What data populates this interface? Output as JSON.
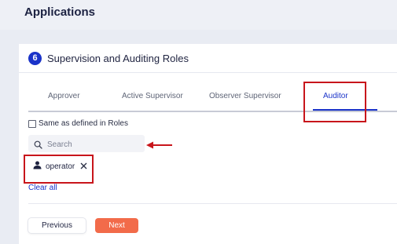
{
  "header": {
    "title": "Applications"
  },
  "section": {
    "step_number": "6",
    "title": "Supervision and Auditing Roles"
  },
  "tabs": [
    {
      "label": "Approver",
      "active": false
    },
    {
      "label": "Active Supervisor",
      "active": false
    },
    {
      "label": "Observer Supervisor",
      "active": false
    },
    {
      "label": "Auditor",
      "active": true
    }
  ],
  "same_as_roles": {
    "label": "Same as defined in Roles",
    "checked": false
  },
  "search": {
    "placeholder": "Search",
    "value": ""
  },
  "selected_chips": [
    {
      "label": "operator",
      "icon": "user-icon"
    }
  ],
  "clear_all_label": "Clear all",
  "buttons": {
    "previous": "Previous",
    "next": "Next"
  },
  "colors": {
    "accent": "#1a33c9",
    "next_button": "#f26b4a",
    "annotation": "#c8151b",
    "background": "#e9ecf3"
  }
}
